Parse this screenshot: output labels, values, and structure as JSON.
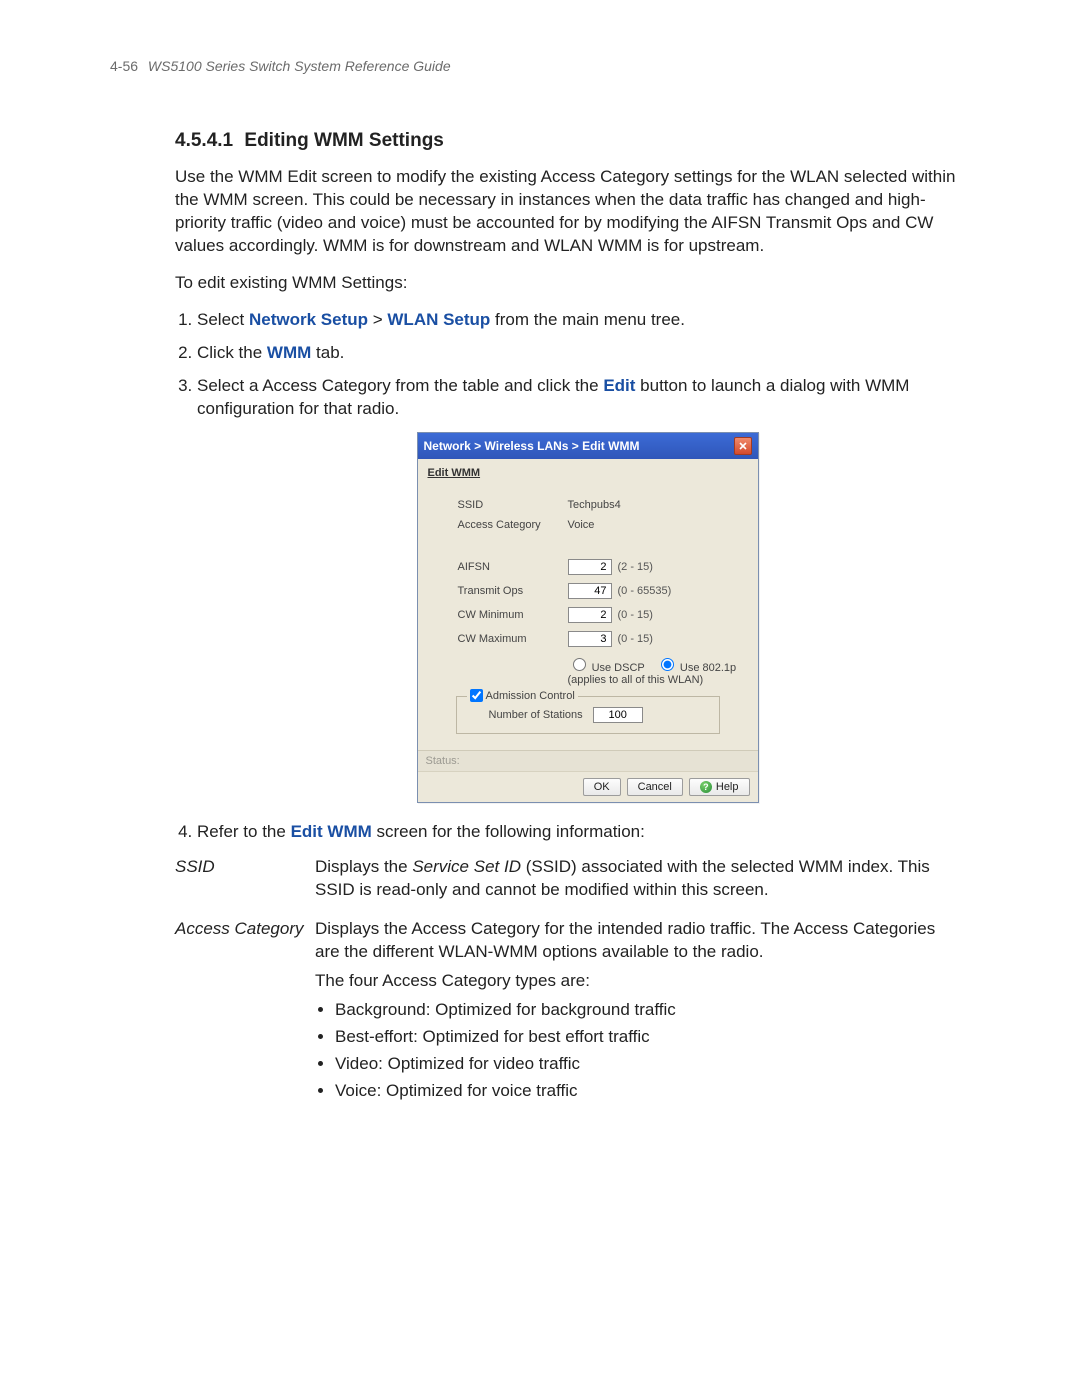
{
  "header": {
    "page_number": "4-56",
    "doc_title": "WS5100 Series Switch System Reference Guide"
  },
  "section": {
    "number": "4.5.4.1",
    "title": "Editing WMM Settings",
    "intro": "Use the WMM Edit screen to modify the existing Access Category settings for the WLAN selected within the WMM screen. This could be necessary in instances when the data traffic has changed and high-priority traffic (video and voice) must be accounted for by modifying the AIFSN Transmit Ops and CW values accordingly. WMM is for downstream and WLAN WMM is for upstream.",
    "lead": "To edit existing WMM Settings:",
    "steps": {
      "s1_pre": "Select ",
      "s1_kw1": "Network Setup",
      "s1_mid": " > ",
      "s1_kw2": "WLAN Setup",
      "s1_post": " from the main menu tree.",
      "s2_pre": "Click the ",
      "s2_kw": "WMM",
      "s2_post": " tab.",
      "s3_pre": "Select a Access Category from the table and click the ",
      "s3_kw": "Edit",
      "s3_post": " button to launch a dialog with WMM configuration for that radio.",
      "s4_pre": "Refer to the ",
      "s4_kw": "Edit WMM",
      "s4_post": " screen for the following information:"
    }
  },
  "dialog": {
    "breadcrumb": "Network > Wireless LANs > Edit WMM",
    "section_label": "Edit WMM",
    "labels": {
      "ssid": "SSID",
      "access_category": "Access Category",
      "aifsn": "AIFSN",
      "transmit_ops": "Transmit Ops",
      "cw_min": "CW Minimum",
      "cw_max": "CW Maximum",
      "use_dscp": "Use DSCP",
      "use_8021p": "Use 802.1p",
      "radio_note": "(applies to all of this WLAN)",
      "admission": "Admission Control",
      "num_stations": "Number of Stations",
      "status": "Status:",
      "ok": "OK",
      "cancel": "Cancel",
      "help": "Help"
    },
    "values": {
      "ssid": "Techpubs4",
      "access_category": "Voice",
      "aifsn": "2",
      "aifsn_hint": "(2 - 15)",
      "transmit_ops": "47",
      "transmit_ops_hint": "(0 - 65535)",
      "cw_min": "2",
      "cw_min_hint": "(0 - 15)",
      "cw_max": "3",
      "cw_max_hint": "(0 - 15)",
      "num_stations": "100"
    }
  },
  "definitions": {
    "ssid": {
      "term": "SSID",
      "desc_pre": "Displays the ",
      "desc_em": "Service Set ID",
      "desc_post": " (SSID) associated with the selected WMM index. This SSID is read-only and cannot be modified within this screen."
    },
    "ac": {
      "term": "Access Category",
      "desc1": "Displays the Access Category for the intended radio traffic. The Access Categories are the different WLAN-WMM options available to the radio.",
      "desc2": "The four Access Category types are:",
      "items": {
        "b1": "Background: Optimized for background traffic",
        "b2": "Best-effort: Optimized for best effort traffic",
        "b3": "Video: Optimized for video traffic",
        "b4": "Voice: Optimized for voice traffic"
      }
    }
  }
}
